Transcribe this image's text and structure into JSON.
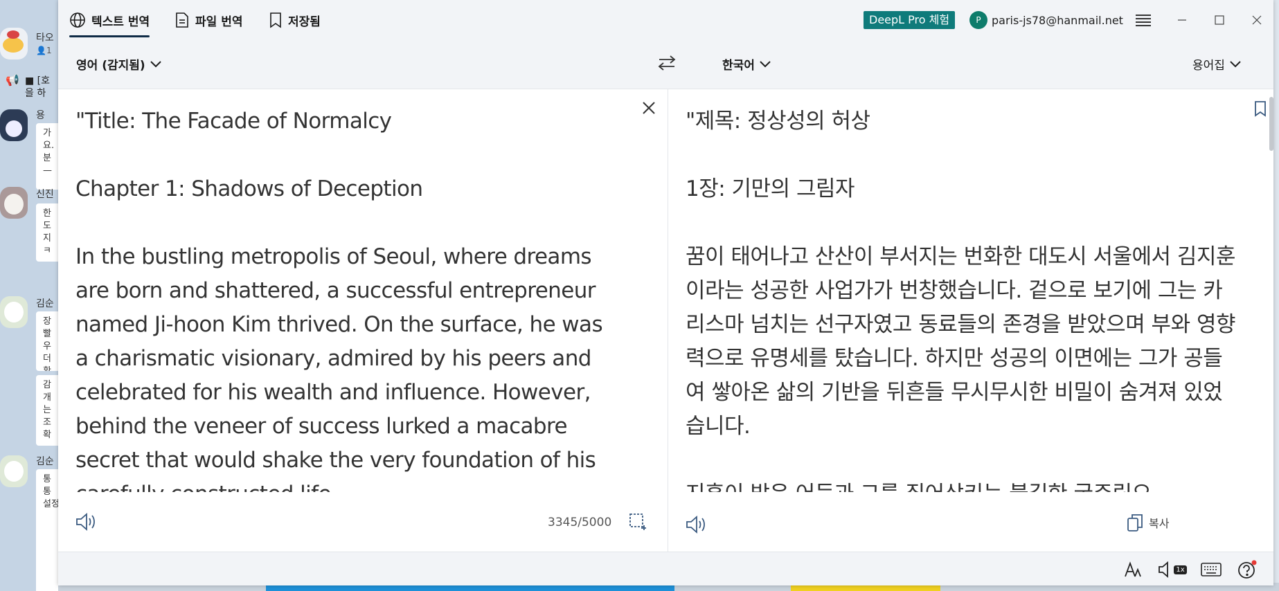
{
  "background_app": {
    "notice": "■ [호\n을 하",
    "chats": [
      {
        "name": "타오",
        "subtitle": "1"
      },
      {
        "name": "용",
        "bubble": "가\n요.\n분\n—"
      },
      {
        "name": "신진",
        "bubble": "한\n도\n지\nㅋ"
      },
      {
        "name": "김순",
        "bubble": "장\n빨\n우\n더\n확"
      },
      {
        "bubble": "감\n개\n는\n조\n확"
      },
      {
        "name": "김순",
        "bubble": "통\n통\n설정이 되어 있나봅니다"
      }
    ]
  },
  "nav": {
    "tabs": [
      {
        "label": "텍스트 번역",
        "icon": "globe-icon",
        "active": true
      },
      {
        "label": "파일 번역",
        "icon": "document-icon",
        "active": false
      },
      {
        "label": "저장됨",
        "icon": "bookmark-icon",
        "active": false
      }
    ],
    "pro_badge": "DeepL Pro 체험",
    "account": {
      "initial": "P",
      "email": "paris-js78@hanmail.net"
    }
  },
  "langbar": {
    "source_lang": "영어 (감지됨)",
    "target_lang": "한국어",
    "glossary": "용어집"
  },
  "source": {
    "text": "\"Title: The Facade of Normalcy\n\nChapter 1: Shadows of Deception\n\nIn the bustling metropolis of Seoul, where dreams are born and shattered, a successful entrepreneur named Ji-hoon Kim thrived. On the surface, he was a charismatic visionary, admired by his peers and celebrated for his wealth and influence. However, behind the veneer of success lurked a macabre secret that would shake the very foundation of his carefully constructed life.",
    "char_count": "3345/5000"
  },
  "target": {
    "text": "\"제목: 정상성의 허상\n\n1장: 기만의 그림자\n\n꿈이 태어나고 산산이 부서지는 번화한 대도시 서울에서 김지훈이라는 성공한 사업가가 번창했습니다. 겉으로 보기에 그는 카리스마 넘치는 선구자였고 동료들의 존경을 받았으며 부와 영향력으로 유명세를 탔습니다. 하지만 성공의 이면에는 그가 공들여 쌓아온 삶의 기반을 뒤흔들 무시무시한 비밀이 숨겨져 있었습니다.\n\n지훈이 밤은 어둠과 그를 집어삼키는 불길한 굶주림으",
    "copy_label": "복사"
  },
  "statusbar": {
    "speed_badge": "1x"
  },
  "colors": {
    "brand_teal": "#0f7b7b",
    "nav_active": "#0f2b46",
    "alert_dot": "#e53935"
  }
}
